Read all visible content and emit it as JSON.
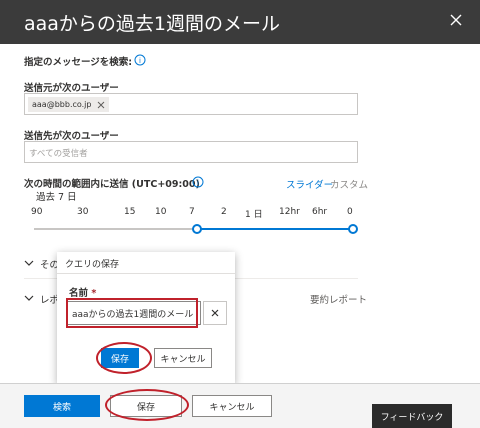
{
  "header": {
    "title": "aaaからの過去1週間のメール"
  },
  "search_section": {
    "heading": "指定のメッセージを検索:"
  },
  "from": {
    "label": "送信元が次のユーザー",
    "chip": "aaa@bbb.co.jp"
  },
  "to": {
    "label": "送信先が次のユーザー",
    "placeholder": "すべての受信者"
  },
  "time": {
    "label": "次の時間の範囲内に送信 (UTC+09:00)",
    "mode_slider": "スライダー",
    "mode_custom": "カスタム",
    "range_value": "過去 7 日",
    "ticks": [
      "90",
      "30",
      "15",
      "10",
      "7",
      "2",
      "1 日",
      "12hr",
      "6hr",
      "0"
    ],
    "selected_start": "7",
    "selected_end": "0"
  },
  "sections": {
    "section1_label": "その",
    "section2_label": "レポ",
    "report_text": "要約レポート"
  },
  "save_query_popup": {
    "title": "クエリの保存",
    "name_label": "名前",
    "required_mark": "*",
    "name_value": "aaaからの過去1週間のメール",
    "save": "保存",
    "cancel": "キャンセル"
  },
  "footer": {
    "search": "検索",
    "save": "保存",
    "cancel": "キャンセル",
    "feedback": "フィードバック"
  },
  "colors": {
    "header_bg": "#3b3b3b",
    "primary": "#0078d4",
    "annotation_red": "#c0212b",
    "feedback_bg": "#2b2b2b"
  },
  "icons": [
    "close-icon",
    "info-icon",
    "chip-remove-icon",
    "chevron-down-icon",
    "clear-icon"
  ]
}
